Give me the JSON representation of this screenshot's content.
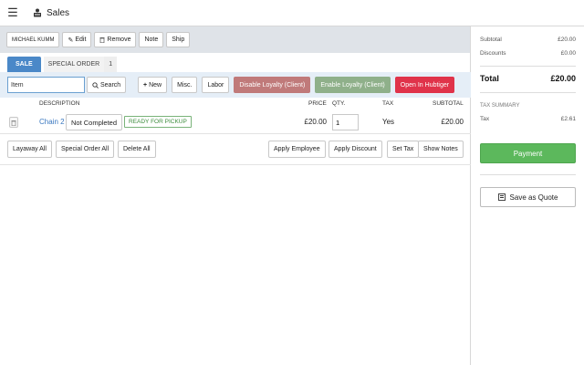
{
  "header": {
    "title": "Sales"
  },
  "customer_bar": {
    "customer_label": "MICHAEL KUMM",
    "edit_label": "Edit",
    "remove_label": "Remove",
    "note_label": "Note",
    "ship_label": "Ship"
  },
  "tabs": {
    "sale_label": "SALE",
    "special_order_label": "SPECIAL ORDER",
    "special_order_count": "1"
  },
  "item_bar": {
    "search_placeholder": "Item",
    "search_label": "Search",
    "new_label": "New",
    "misc_label": "Misc.",
    "labor_label": "Labor",
    "disable_loyalty_label": "Disable Loyalty (Client)",
    "enable_loyalty_label": "Enable Loyalty (Client)",
    "hubtiger_label": "Open In Hubtiger"
  },
  "table": {
    "headers": {
      "description": "DESCRIPTION",
      "price": "PRICE",
      "qty": "QTY.",
      "tax": "TAX",
      "subtotal": "SUBTOTAL"
    },
    "rows": [
      {
        "description": "Chain 2",
        "status": "Not Completed",
        "badge": "READY FOR PICKUP",
        "price": "£20.00",
        "qty": "1",
        "tax": "Yes",
        "subtotal": "£20.00"
      }
    ]
  },
  "bottom_actions": {
    "layaway_all": "Layaway All",
    "special_order_all": "Special Order All",
    "delete_all": "Delete All",
    "apply_employee": "Apply Employee",
    "apply_discount": "Apply Discount",
    "set_tax": "Set Tax",
    "show_notes": "Show Notes"
  },
  "summary": {
    "subtotal_label": "Subtotal",
    "subtotal_value": "£20.00",
    "discounts_label": "Discounts",
    "discounts_value": "£0.00",
    "total_label": "Total",
    "total_value": "£20.00",
    "tax_summary_label": "TAX SUMMARY",
    "tax_label": "Tax",
    "tax_value": "£2.61",
    "payment_label": "Payment",
    "quote_label": "Save as Quote"
  },
  "colors": {
    "sale_tab": "#4a88c8",
    "payment": "#5cb85c",
    "hubtiger": "#e0334a",
    "disable_loyalty": "#c07a7a",
    "enable_loyalty": "#8fb08a"
  }
}
